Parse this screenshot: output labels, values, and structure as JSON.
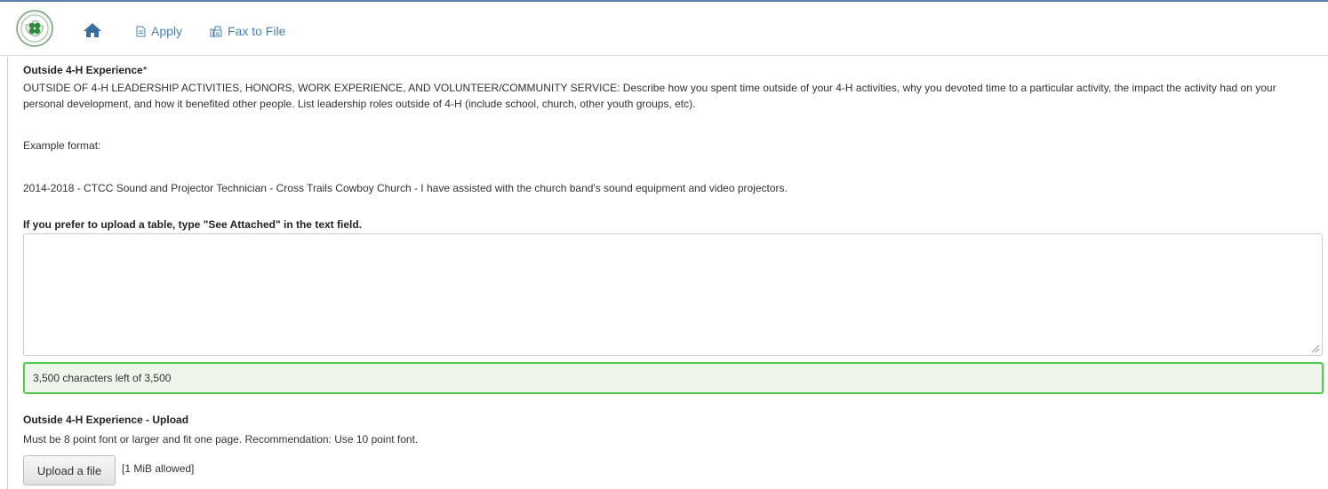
{
  "nav": {
    "apply_label": "Apply",
    "fax_label": "Fax to File"
  },
  "section": {
    "title": "Outside 4-H Experience",
    "required_mark": "*",
    "description": "OUTSIDE OF 4-H LEADERSHIP ACTIVITIES, HONORS, WORK EXPERIENCE, AND VOLUNTEER/COMMUNITY SERVICE:  Describe how you spent time outside of your 4-H activities, why you devoted time to a particular activity, the impact the activity had on your personal development, and how it benefited other people.  List leadership roles outside of 4-H (include school, church, other youth groups, etc).",
    "example_label": "Example format:",
    "example_text": "2014-2018 - CTCC Sound and Projector Technician - Cross Trails Cowboy Church - I have assisted with the church band's sound equipment and video projectors.",
    "upload_table_hint": "If you prefer to upload a table, type \"See Attached\" in the text field.",
    "textarea_value": "",
    "char_counter": "3,500 characters left of 3,500"
  },
  "upload_section": {
    "title": "Outside 4-H Experience - Upload",
    "instructions": "Must be 8 point font or larger and fit one page.  Recommendation: Use 10 point font.",
    "button_label": "Upload a file",
    "size_limit": "[1 MiB allowed]"
  },
  "colors": {
    "link": "#4a7fb0",
    "counter_border": "#4fcc4f",
    "counter_bg": "#eef5ea",
    "logo_green": "#2e8b3d"
  },
  "icons": [
    "4h-clover-logo",
    "home-icon",
    "document-icon",
    "fax-icon",
    "resize-grip-icon"
  ]
}
